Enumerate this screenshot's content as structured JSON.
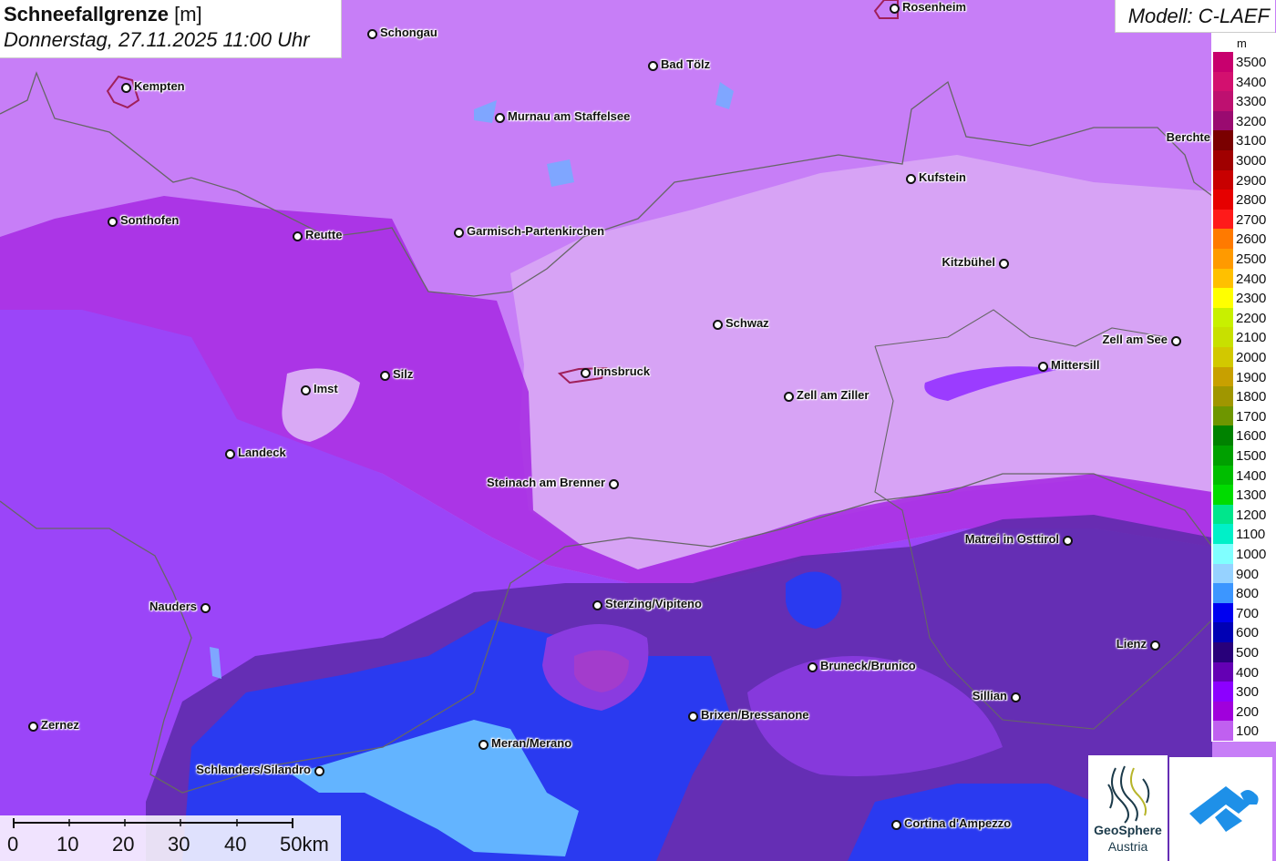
{
  "title": {
    "bold": "Schneefallgrenze",
    "unit": "[m]"
  },
  "date_time": "Donnerstag, 27.11.2025 11:00 Uhr",
  "model": "Modell: C-LAEF",
  "legend": {
    "unit": "m",
    "entries": [
      {
        "label": "3500",
        "color": "#c8006e"
      },
      {
        "label": "3400",
        "color": "#d3106f"
      },
      {
        "label": "3300",
        "color": "#be1070"
      },
      {
        "label": "3200",
        "color": "#9a0a70"
      },
      {
        "label": "3100",
        "color": "#7a0000"
      },
      {
        "label": "3000",
        "color": "#a00000"
      },
      {
        "label": "2900",
        "color": "#c80000"
      },
      {
        "label": "2800",
        "color": "#e60000"
      },
      {
        "label": "2700",
        "color": "#ff1a1a"
      },
      {
        "label": "2600",
        "color": "#ff7a00"
      },
      {
        "label": "2500",
        "color": "#ff9a00"
      },
      {
        "label": "2400",
        "color": "#ffc000"
      },
      {
        "label": "2300",
        "color": "#ffff00"
      },
      {
        "label": "2200",
        "color": "#c8f000"
      },
      {
        "label": "2100",
        "color": "#c8e000"
      },
      {
        "label": "2000",
        "color": "#d2c800"
      },
      {
        "label": "1900",
        "color": "#c8a000"
      },
      {
        "label": "1800",
        "color": "#a09600"
      },
      {
        "label": "1700",
        "color": "#6e9600"
      },
      {
        "label": "1600",
        "color": "#008200"
      },
      {
        "label": "1500",
        "color": "#00a000"
      },
      {
        "label": "1400",
        "color": "#00be00"
      },
      {
        "label": "1300",
        "color": "#00dc00"
      },
      {
        "label": "1200",
        "color": "#00e68c"
      },
      {
        "label": "1100",
        "color": "#00f0c8"
      },
      {
        "label": "1000",
        "color": "#80ffff"
      },
      {
        "label": "900",
        "color": "#96d2ff"
      },
      {
        "label": "800",
        "color": "#3c96ff"
      },
      {
        "label": "700",
        "color": "#0000f0"
      },
      {
        "label": "600",
        "color": "#0000b4"
      },
      {
        "label": "500",
        "color": "#28007a"
      },
      {
        "label": "400",
        "color": "#6400b4"
      },
      {
        "label": "300",
        "color": "#8c00ff"
      },
      {
        "label": "200",
        "color": "#a000dc"
      },
      {
        "label": "100",
        "color": "#c060f0"
      }
    ]
  },
  "cities": [
    {
      "name": "Rosenheim"
    },
    {
      "name": "Schongau"
    },
    {
      "name": "Kempten"
    },
    {
      "name": "Bad Tölz"
    },
    {
      "name": "Murnau am Staffelsee"
    },
    {
      "name": "Berchte"
    },
    {
      "name": "Kufstein"
    },
    {
      "name": "Sonthofen"
    },
    {
      "name": "Reutte"
    },
    {
      "name": "Garmisch-Partenkirchen"
    },
    {
      "name": "Kitzbühel"
    },
    {
      "name": "Schwaz"
    },
    {
      "name": "Zell am See"
    },
    {
      "name": "Imst"
    },
    {
      "name": "Silz"
    },
    {
      "name": "Innsbruck"
    },
    {
      "name": "Mittersill"
    },
    {
      "name": "Zell am Ziller"
    },
    {
      "name": "Landeck"
    },
    {
      "name": "Steinach am Brenner"
    },
    {
      "name": "Matrei in Osttirol"
    },
    {
      "name": "Nauders"
    },
    {
      "name": "Sterzing/Vipiteno"
    },
    {
      "name": "Lienz"
    },
    {
      "name": "Bruneck/Brunico"
    },
    {
      "name": "Sillian"
    },
    {
      "name": "Zernez"
    },
    {
      "name": "Brixen/Bressanone"
    },
    {
      "name": "Meran/Merano"
    },
    {
      "name": "Schlanders/Silandro"
    },
    {
      "name": "Cortina d'Ampezzo"
    }
  ],
  "scale_bar": {
    "labels": [
      "0",
      "10",
      "20",
      "30",
      "40",
      "50km"
    ]
  },
  "logos": {
    "geosphere_line1": "GeoSphere",
    "geosphere_line2": "Austria"
  },
  "colors": {
    "base": "#c77ef7",
    "snowline_low": "#d9a9f5",
    "band_200": "#a529e6",
    "band_300": "#9b3cff",
    "band_400": "#6a2ab8",
    "band_500": "#3d1a78",
    "band_700": "#2a3af0",
    "band_900": "#63b4ff"
  }
}
